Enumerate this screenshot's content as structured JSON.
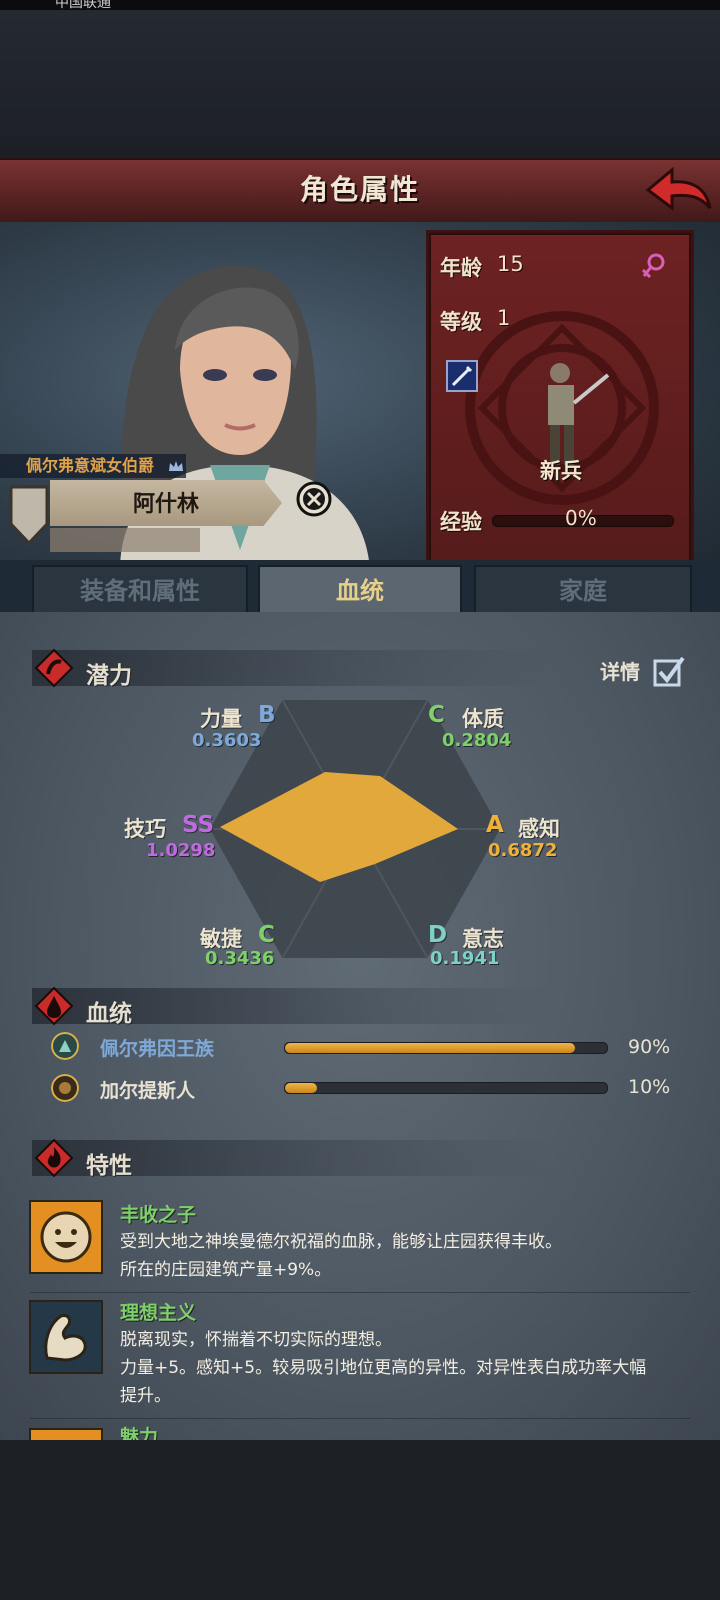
{
  "status_bar": {
    "text": "中国联通"
  },
  "header": {
    "title": "角色属性",
    "back_icon": "back-arrow-icon"
  },
  "character": {
    "noble_title": "佩尔弗意斌女伯爵",
    "name": "阿什林",
    "age_label": "年龄",
    "age": "15",
    "level_label": "等级",
    "level": "1",
    "gender_icon": "female-icon",
    "job": "新兵",
    "exp_label": "经验",
    "exp": "0%",
    "exp_progress": 0.0
  },
  "tabs": [
    {
      "label": "装备和属性",
      "active": false
    },
    {
      "label": "血统",
      "active": true
    },
    {
      "label": "家庭",
      "active": false
    }
  ],
  "potential": {
    "title": "潜力",
    "detail_label": "详情",
    "detail_checked": true,
    "stats": [
      {
        "name": "力量",
        "grade": "B",
        "value": "0.3603",
        "color": "#7fa9d9"
      },
      {
        "name": "体质",
        "grade": "C",
        "value": "0.2804",
        "color": "#7fd06b"
      },
      {
        "name": "感知",
        "grade": "A",
        "value": "0.6872",
        "color": "#f0b13c"
      },
      {
        "name": "意志",
        "grade": "D",
        "value": "0.1941",
        "color": "#7fd0c5"
      },
      {
        "name": "敏捷",
        "grade": "C",
        "value": "0.3436",
        "color": "#7fd06b"
      },
      {
        "name": "技巧",
        "grade": "SS",
        "value": "1.0298",
        "color": "#c06ae0"
      }
    ],
    "radar_fill": "#e3a83c"
  },
  "bloodline": {
    "title": "血统",
    "items": [
      {
        "name": "佩尔弗因王族",
        "percent": "90%",
        "progress": 0.9,
        "color": "#7fa9d9"
      },
      {
        "name": "加尔提斯人",
        "percent": "10%",
        "progress": 0.1,
        "color": "#e8e2d2"
      }
    ]
  },
  "traits": {
    "title": "特性",
    "items": [
      {
        "name": "丰收之子",
        "lines": [
          "受到大地之神埃曼德尔祝福的血脉，能够让庄园获得丰收。",
          "所在的庄园建筑产量+9%。"
        ],
        "icon": "smiley-icon"
      },
      {
        "name": "理想主义",
        "lines": [
          "脱离现实，怀揣着不切实际的理想。",
          "力量+5。感知+5。较易吸引地位更高的异性。对异性表白成功率大幅",
          "提升。"
        ],
        "icon": "flexed-arm-icon"
      },
      {
        "name": "魅力",
        "lines": [],
        "icon": "charm-icon"
      }
    ]
  }
}
